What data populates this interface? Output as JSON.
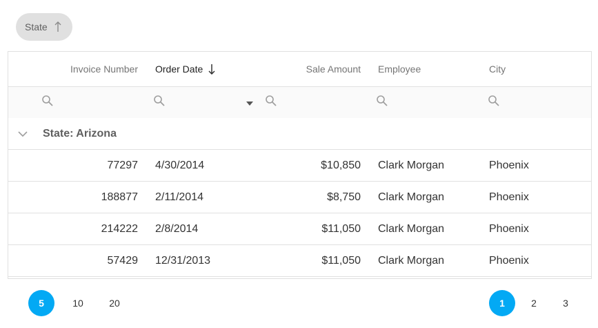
{
  "group_panel": {
    "chip_label": "State",
    "sort_direction": "ascending"
  },
  "columns": {
    "invoice_number": "Invoice Number",
    "order_date": "Order Date",
    "sale_amount": "Sale Amount",
    "employee": "Employee",
    "city": "City"
  },
  "sorted_column": "order_date",
  "icons": {
    "search": "search-icon",
    "chevron_down": "chevron-down-icon",
    "sort_up": "arrow-up-icon",
    "sort_down": "arrow-down-icon",
    "dropdown": "caret-down-icon"
  },
  "group": {
    "label": "State: Arizona",
    "expanded": true
  },
  "rows": [
    {
      "invoice": "77297",
      "date": "4/30/2014",
      "amount": "$10,850",
      "employee": "Clark Morgan",
      "city": "Phoenix"
    },
    {
      "invoice": "188877",
      "date": "2/11/2014",
      "amount": "$8,750",
      "employee": "Clark Morgan",
      "city": "Phoenix"
    },
    {
      "invoice": "214222",
      "date": "2/8/2014",
      "amount": "$11,050",
      "employee": "Clark Morgan",
      "city": "Phoenix"
    },
    {
      "invoice": "57429",
      "date": "12/31/2013",
      "amount": "$11,050",
      "employee": "Clark Morgan",
      "city": "Phoenix"
    }
  ],
  "pager": {
    "page_sizes": [
      "5",
      "10",
      "20"
    ],
    "selected_page_size": "5",
    "pages": [
      "1",
      "2",
      "3"
    ],
    "current_page": "1"
  },
  "colors": {
    "accent": "#03a9f4",
    "chip_bg": "#e0e0e0",
    "border": "#e0e0e0"
  }
}
